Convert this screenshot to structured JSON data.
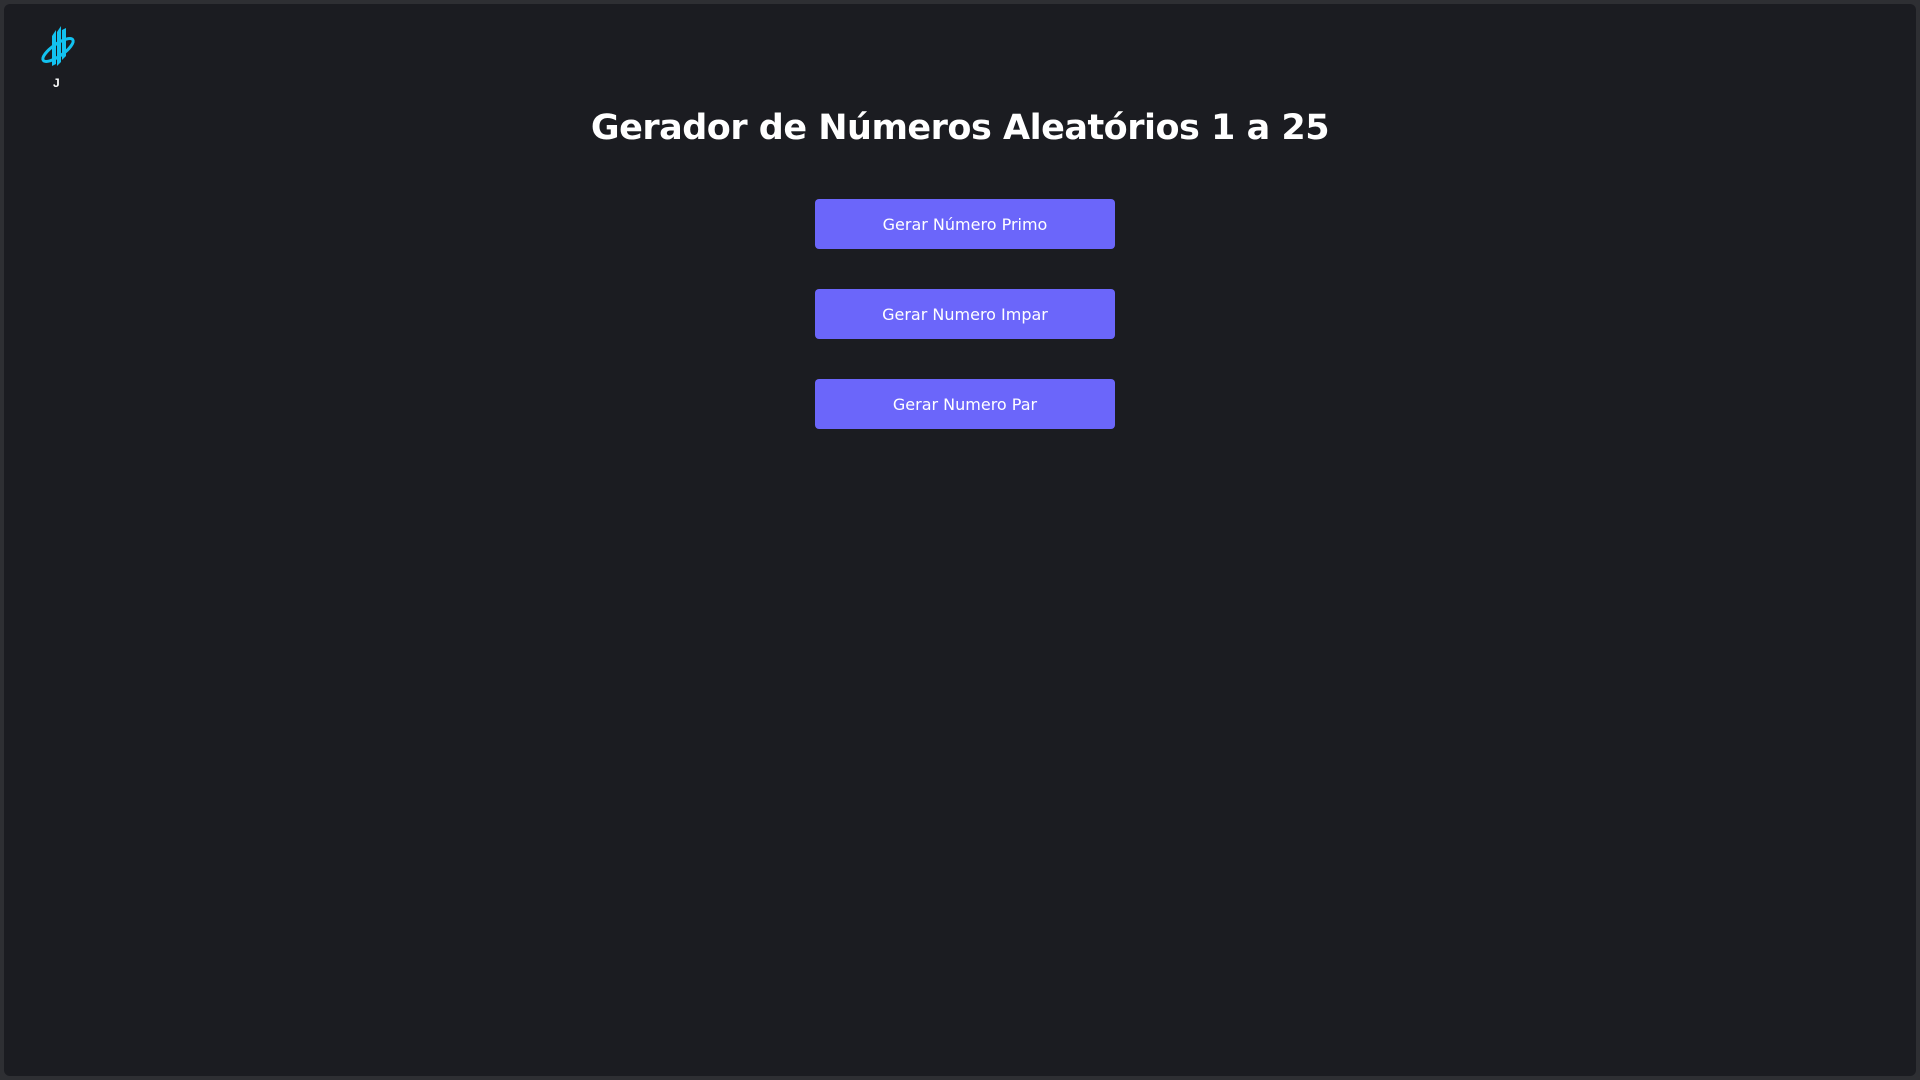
{
  "logo": {
    "letter": "J",
    "color": "#12c2f0"
  },
  "title": "Gerador de Números Aleatórios 1 a 25",
  "buttons": [
    {
      "label": "Gerar Número Primo"
    },
    {
      "label": "Gerar Numero Impar"
    },
    {
      "label": "Gerar Numero Par"
    }
  ],
  "colors": {
    "background": "#1b1c21",
    "button": "#6b66fa"
  }
}
